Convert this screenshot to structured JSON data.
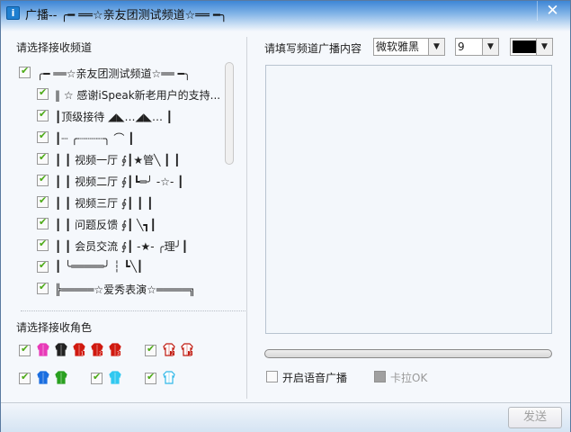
{
  "window": {
    "title": "广播-- ╭━ ══☆亲友团测试频道☆══ ━╮",
    "close_icon": "close-icon"
  },
  "left": {
    "channels_label": "请选择接收频道",
    "channels": [
      {
        "label": "╭━ ══☆亲友团测试频道☆══ ━╮",
        "checked": true,
        "level": 0
      },
      {
        "label": "‖ ☆ 感谢iSpeak新老用户的支持...",
        "checked": true,
        "level": 1
      },
      {
        "label": "┃顶级接待          ◢◣…◢◣…  ┃",
        "checked": true,
        "level": 1
      },
      {
        "label": "┃┈ ╭┈┈┈┈╮   ⌒         ┃",
        "checked": true,
        "level": 1
      },
      {
        "label": "┃  ┃ 视频一厅 ∮┃★管╲   ┃   ┃",
        "checked": true,
        "level": 1
      },
      {
        "label": "┃  ┃ 视频二厅 ∮┃┗═╯ -☆-  ┃",
        "checked": true,
        "level": 1
      },
      {
        "label": "┃  ┃ 视频三厅 ∮┃        ┃   ┃",
        "checked": true,
        "level": 1
      },
      {
        "label": "┃  ┃ 问题反馈 ∮┃       ╲┓┃",
        "checked": true,
        "level": 1
      },
      {
        "label": "┃  ┃ 会员交流 ∮┃ -★-   ╭理╯┃",
        "checked": true,
        "level": 1
      },
      {
        "label": "┃   ╰═════╯   ┆  ┗╲┃",
        "checked": true,
        "level": 1
      },
      {
        "label": "╠═════☆爱秀表演☆═════╗",
        "checked": true,
        "level": 1
      }
    ],
    "roles_label": "请选择接收角色",
    "role_groups": [
      {
        "checked": true,
        "shirts": [
          {
            "color": "#e83ab8",
            "num": ""
          },
          {
            "color": "#222222",
            "num": ""
          },
          {
            "color": "#d01a10",
            "num": "1"
          },
          {
            "color": "#d01a10",
            "num": "2"
          },
          {
            "color": "#d01a10",
            "num": "3"
          }
        ]
      },
      {
        "checked": true,
        "shirts": [
          {
            "color": "#c01a10",
            "num": "2",
            "outline": true
          },
          {
            "color": "#c01a10",
            "num": "3",
            "outline": true
          }
        ]
      },
      {
        "checked": true,
        "shirts": [
          {
            "color": "#1a6ee0",
            "num": ""
          },
          {
            "color": "#2aa020",
            "num": ""
          }
        ]
      },
      {
        "checked": true,
        "shirts": [
          {
            "color": "#30c8f0",
            "num": ""
          }
        ]
      },
      {
        "checked": true,
        "shirts": [
          {
            "color": "#30b8e8",
            "num": "",
            "outline": true
          }
        ]
      }
    ]
  },
  "right": {
    "content_label": "请填写频道广播内容",
    "font": "微软雅黑",
    "size": "9",
    "color": "#000000",
    "message": "",
    "progress": 0,
    "voice_label": "开启语音广播",
    "voice_checked": false,
    "karaoke_label": "卡拉OK",
    "karaoke_enabled": false
  },
  "footer": {
    "send_label": "发送"
  }
}
